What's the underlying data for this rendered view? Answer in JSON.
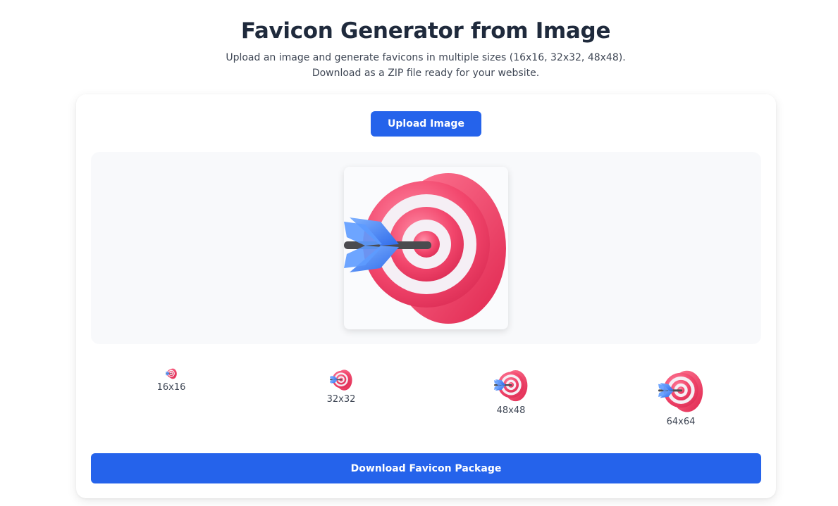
{
  "header": {
    "title": "Favicon Generator from Image",
    "subtitle_line1": "Upload an image and generate favicons in multiple sizes (16x16, 32x32, 48x48).",
    "subtitle_line2": "Download as a ZIP file ready for your website."
  },
  "upload": {
    "label": "Upload Image"
  },
  "preview": {
    "icon": "target-dartboard-arrow-icon"
  },
  "sizes": [
    {
      "label": "16x16",
      "icon": "target-icon"
    },
    {
      "label": "32x32",
      "icon": "target-icon"
    },
    {
      "label": "48x48",
      "icon": "target-icon"
    },
    {
      "label": "64x64",
      "icon": "target-icon"
    }
  ],
  "download": {
    "label": "Download Favicon Package"
  },
  "colors": {
    "primary": "#2563eb",
    "target_red": "#f2466c",
    "target_white": "#f5eff5",
    "arrow_blue": "#3b82f6",
    "arrow_shaft": "#4b4b4f"
  }
}
